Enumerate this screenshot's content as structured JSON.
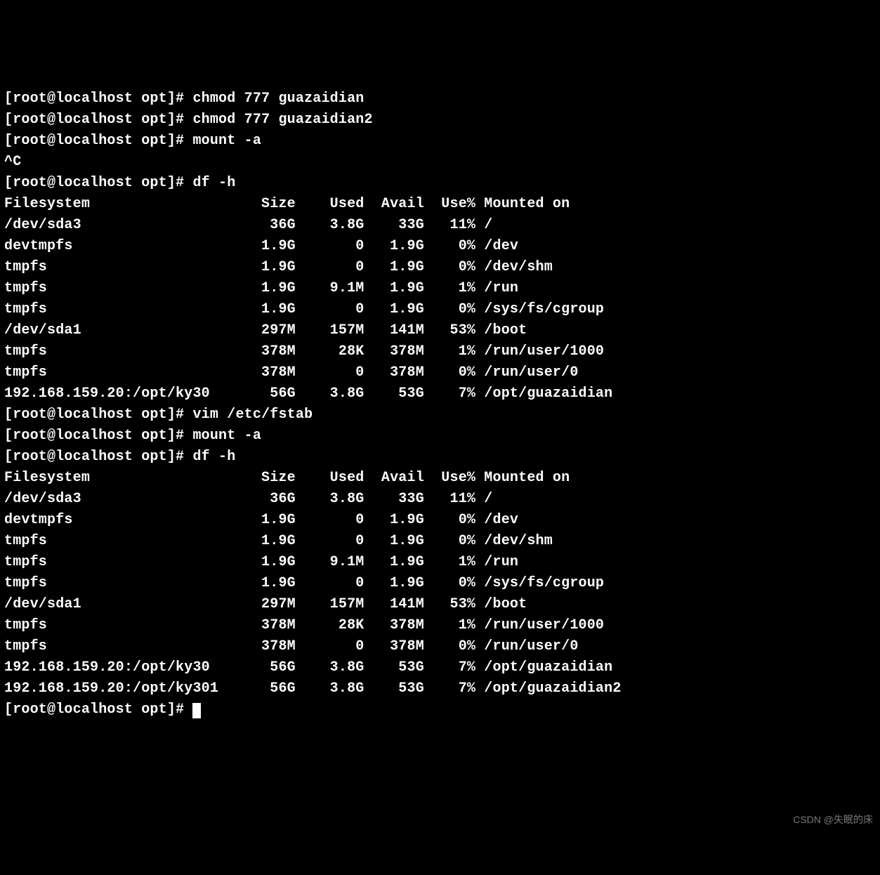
{
  "prompt": "[root@localhost opt]# ",
  "interrupt": "^C",
  "commands": {
    "cmd0": "chmod 777 guazaidian",
    "cmd1": "chmod 777 guazaidian2",
    "cmd2": "mount -a",
    "cmd3": "df -h",
    "cmd4": "vim /etc/fstab",
    "cmd5": "mount -a",
    "cmd6": "df -h"
  },
  "df1": {
    "header": {
      "fs": "Filesystem",
      "size": "Size",
      "used": "Used",
      "avail": "Avail",
      "usep": "Use%",
      "mnt": "Mounted on"
    },
    "rows": [
      {
        "fs": "/dev/sda3",
        "size": "36G",
        "used": "3.8G",
        "avail": "33G",
        "usep": "11%",
        "mnt": "/"
      },
      {
        "fs": "devtmpfs",
        "size": "1.9G",
        "used": "0",
        "avail": "1.9G",
        "usep": "0%",
        "mnt": "/dev"
      },
      {
        "fs": "tmpfs",
        "size": "1.9G",
        "used": "0",
        "avail": "1.9G",
        "usep": "0%",
        "mnt": "/dev/shm"
      },
      {
        "fs": "tmpfs",
        "size": "1.9G",
        "used": "9.1M",
        "avail": "1.9G",
        "usep": "1%",
        "mnt": "/run"
      },
      {
        "fs": "tmpfs",
        "size": "1.9G",
        "used": "0",
        "avail": "1.9G",
        "usep": "0%",
        "mnt": "/sys/fs/cgroup"
      },
      {
        "fs": "/dev/sda1",
        "size": "297M",
        "used": "157M",
        "avail": "141M",
        "usep": "53%",
        "mnt": "/boot"
      },
      {
        "fs": "tmpfs",
        "size": "378M",
        "used": "28K",
        "avail": "378M",
        "usep": "1%",
        "mnt": "/run/user/1000"
      },
      {
        "fs": "tmpfs",
        "size": "378M",
        "used": "0",
        "avail": "378M",
        "usep": "0%",
        "mnt": "/run/user/0"
      },
      {
        "fs": "192.168.159.20:/opt/ky30",
        "size": "56G",
        "used": "3.8G",
        "avail": "53G",
        "usep": "7%",
        "mnt": "/opt/guazaidian"
      }
    ]
  },
  "df2": {
    "header": {
      "fs": "Filesystem",
      "size": "Size",
      "used": "Used",
      "avail": "Avail",
      "usep": "Use%",
      "mnt": "Mounted on"
    },
    "rows": [
      {
        "fs": "/dev/sda3",
        "size": "36G",
        "used": "3.8G",
        "avail": "33G",
        "usep": "11%",
        "mnt": "/"
      },
      {
        "fs": "devtmpfs",
        "size": "1.9G",
        "used": "0",
        "avail": "1.9G",
        "usep": "0%",
        "mnt": "/dev"
      },
      {
        "fs": "tmpfs",
        "size": "1.9G",
        "used": "0",
        "avail": "1.9G",
        "usep": "0%",
        "mnt": "/dev/shm"
      },
      {
        "fs": "tmpfs",
        "size": "1.9G",
        "used": "9.1M",
        "avail": "1.9G",
        "usep": "1%",
        "mnt": "/run"
      },
      {
        "fs": "tmpfs",
        "size": "1.9G",
        "used": "0",
        "avail": "1.9G",
        "usep": "0%",
        "mnt": "/sys/fs/cgroup"
      },
      {
        "fs": "/dev/sda1",
        "size": "297M",
        "used": "157M",
        "avail": "141M",
        "usep": "53%",
        "mnt": "/boot"
      },
      {
        "fs": "tmpfs",
        "size": "378M",
        "used": "28K",
        "avail": "378M",
        "usep": "1%",
        "mnt": "/run/user/1000"
      },
      {
        "fs": "tmpfs",
        "size": "378M",
        "used": "0",
        "avail": "378M",
        "usep": "0%",
        "mnt": "/run/user/0"
      },
      {
        "fs": "192.168.159.20:/opt/ky30",
        "size": "56G",
        "used": "3.8G",
        "avail": "53G",
        "usep": "7%",
        "mnt": "/opt/guazaidian"
      },
      {
        "fs": "192.168.159.20:/opt/ky301",
        "size": "56G",
        "used": "3.8G",
        "avail": "53G",
        "usep": "7%",
        "mnt": "/opt/guazaidian2"
      }
    ]
  },
  "columns": {
    "fs": 27,
    "size": 7,
    "used": 6,
    "avail": 6,
    "usep": 5
  },
  "watermark": "CSDN @失眠的床"
}
